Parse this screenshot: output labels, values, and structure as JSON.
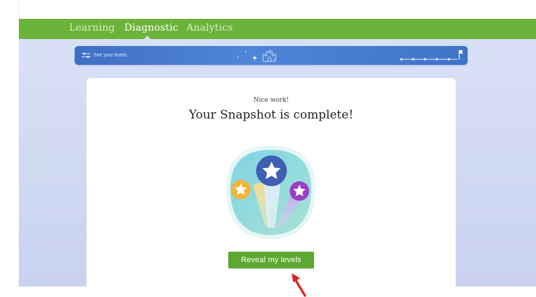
{
  "nav": {
    "items": [
      {
        "label": "Learning",
        "active": false
      },
      {
        "label": "Diagnostic",
        "active": true
      },
      {
        "label": "Analytics",
        "active": false
      }
    ]
  },
  "banner": {
    "levels_link": "See your levels",
    "icons": [
      "sliders-icon",
      "stars-icon",
      "castle-icon",
      "flag-icon"
    ]
  },
  "card": {
    "eyebrow": "Nice work!",
    "heading": "Your Snapshot is complete!",
    "badge_icon": "snapshot-stars-badge",
    "button_label": "Reveal my levels"
  },
  "colors": {
    "topbar": "#6bb33a",
    "banner": "#4f86d8",
    "button": "#5ea832",
    "annotation_arrow": "#e02020"
  }
}
